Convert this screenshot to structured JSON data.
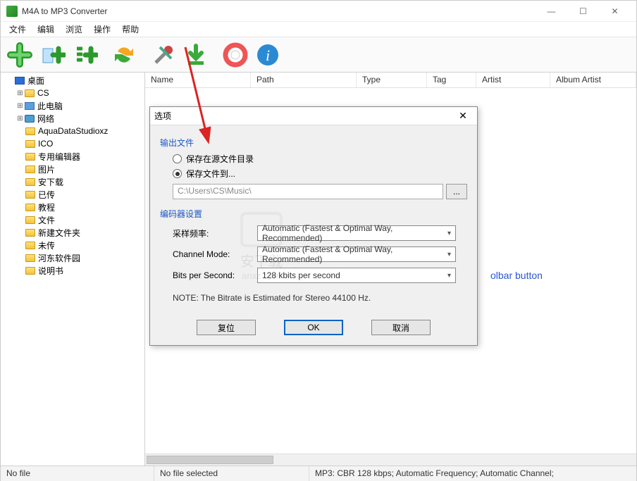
{
  "window": {
    "title": "M4A to MP3 Converter"
  },
  "menu": {
    "file": "文件",
    "edit": "编辑",
    "browse": "浏览",
    "action": "操作",
    "help": "帮助"
  },
  "columns": {
    "name": "Name",
    "path": "Path",
    "type": "Type",
    "tag": "Tag",
    "artist": "Artist",
    "album_artist": "Album Artist"
  },
  "tree": {
    "root": "桌面",
    "items": [
      "CS",
      "此电脑",
      "网络",
      "AquaDataStudioxz",
      "ICO",
      "专用编辑器",
      "图片",
      "安下载",
      "已传",
      "教程",
      "文件",
      "新建文件夹",
      "未传",
      "河东软件园",
      "说明书"
    ]
  },
  "annotation": {
    "toolbar_hint": "olbar button"
  },
  "status": {
    "left": "No file",
    "mid": "No file selected",
    "right": "MP3:  CBR 128 kbps; Automatic Frequency; Automatic Channel;"
  },
  "dialog": {
    "title": "选项",
    "output_group": "输出文件",
    "opt_source": "保存在源文件目录",
    "opt_saveto": "保存文件到...",
    "path_value": "C:\\Users\\CS\\Music\\",
    "browse": "...",
    "encoder_group": "编码器设置",
    "rows": {
      "sample_rate": {
        "label": "采样频率:",
        "value": "Automatic (Fastest & Optimal Way, Recommended)"
      },
      "channel": {
        "label": "Channel Mode:",
        "value": "Automatic (Fastest & Optimal Way, Recommended)"
      },
      "bps": {
        "label": "Bits per Second:",
        "value": "128 kbits per second"
      }
    },
    "note": "NOTE: The Bitrate is Estimated  for Stereo 44100 Hz.",
    "buttons": {
      "reset": "复位",
      "ok": "OK",
      "cancel": "取消"
    }
  },
  "watermark": {
    "line1": "安下载",
    "line2": "anxz.com"
  }
}
